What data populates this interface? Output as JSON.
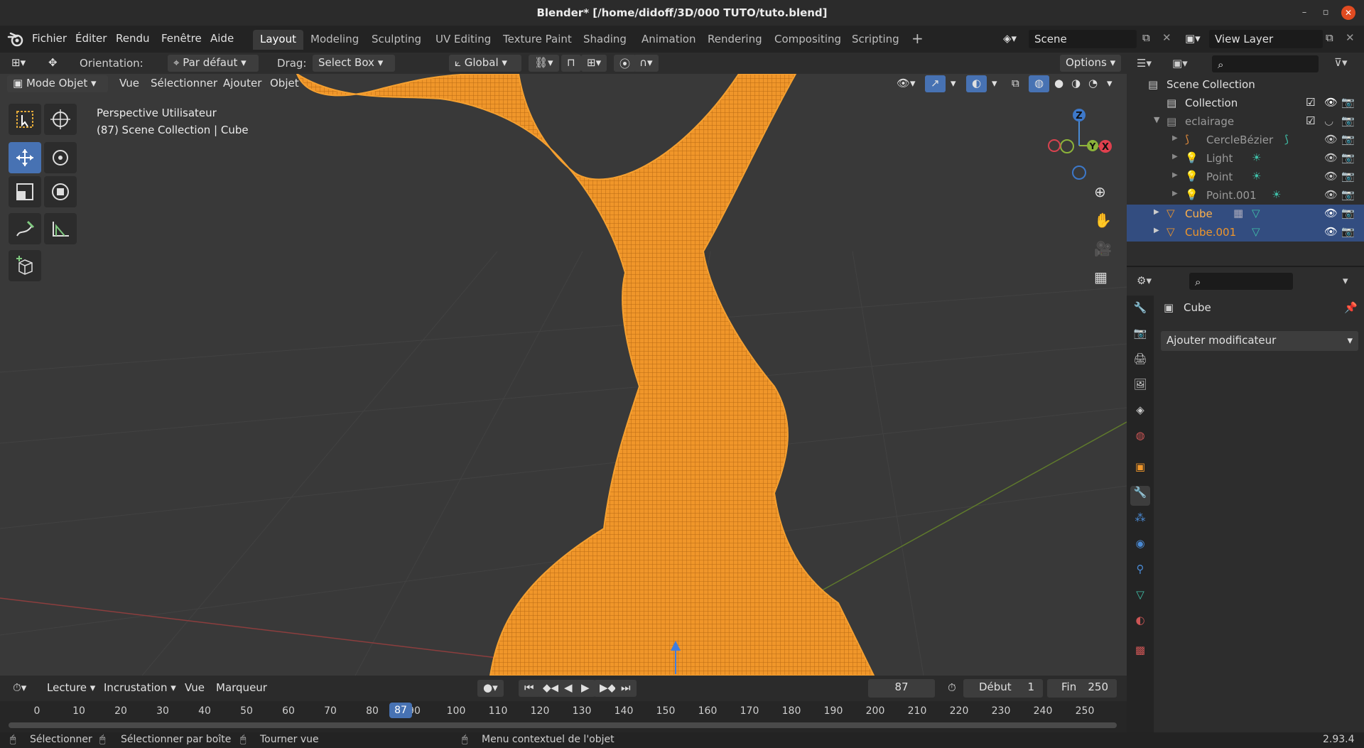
{
  "window": {
    "title": "Blender* [/home/didoff/3D/000 TUTO/tuto.blend]"
  },
  "menu": {
    "items": [
      "Fichier",
      "Éditer",
      "Rendu",
      "Fenêtre",
      "Aide"
    ]
  },
  "workspaces": {
    "tabs": [
      "Layout",
      "Modeling",
      "Sculpting",
      "UV Editing",
      "Texture Paint",
      "Shading",
      "Animation",
      "Rendering",
      "Compositing",
      "Scripting"
    ],
    "active": "Layout"
  },
  "scene": {
    "name": "Scene"
  },
  "view_layer": {
    "name": "View Layer"
  },
  "tool_header": {
    "orientation_label": "Orientation:",
    "orientation_value": "Par défaut",
    "drag_label": "Drag:",
    "drag_value": "Select Box",
    "transform_value": "Global",
    "options_label": "Options"
  },
  "viewport_header": {
    "mode": "Mode Objet",
    "menus": [
      "Vue",
      "Sélectionner",
      "Ajouter",
      "Objet"
    ]
  },
  "viewport": {
    "view_name": "Perspective Utilisateur",
    "info": "(87) Scene Collection | Cube",
    "gizmo": {
      "z": "Z",
      "y": "Y",
      "x": "X"
    }
  },
  "outliner": {
    "root": "Scene Collection",
    "rows": [
      {
        "label": "Collection"
      },
      {
        "label": "eclairage"
      },
      {
        "label": "CercleBézier"
      },
      {
        "label": "Light"
      },
      {
        "label": "Point"
      },
      {
        "label": "Point.001"
      },
      {
        "label": "Cube"
      },
      {
        "label": "Cube.001"
      }
    ]
  },
  "properties": {
    "object_name": "Cube",
    "add_modifier": "Ajouter modificateur"
  },
  "timeline": {
    "menus": [
      "Lecture",
      "Incrustation",
      "Vue",
      "Marqueur"
    ],
    "current_frame": "87",
    "start_label": "Début",
    "start_value": "1",
    "end_label": "Fin",
    "end_value": "250",
    "ticks": [
      "0",
      "10",
      "20",
      "30",
      "40",
      "50",
      "60",
      "70",
      "80",
      "90",
      "100",
      "110",
      "120",
      "130",
      "140",
      "150",
      "160",
      "170",
      "180",
      "190",
      "200",
      "210",
      "220",
      "230",
      "240",
      "250"
    ]
  },
  "statusbar": {
    "select": "Sélectionner",
    "box_select": "Sélectionner par boîte",
    "rotate_view": "Tourner vue",
    "context_menu": "Menu contextuel de l'objet",
    "version": "2.93.4"
  },
  "colors": {
    "accent": "#4772b3",
    "selected_object": "#f5a030",
    "outliner_selection": "#334d80"
  }
}
